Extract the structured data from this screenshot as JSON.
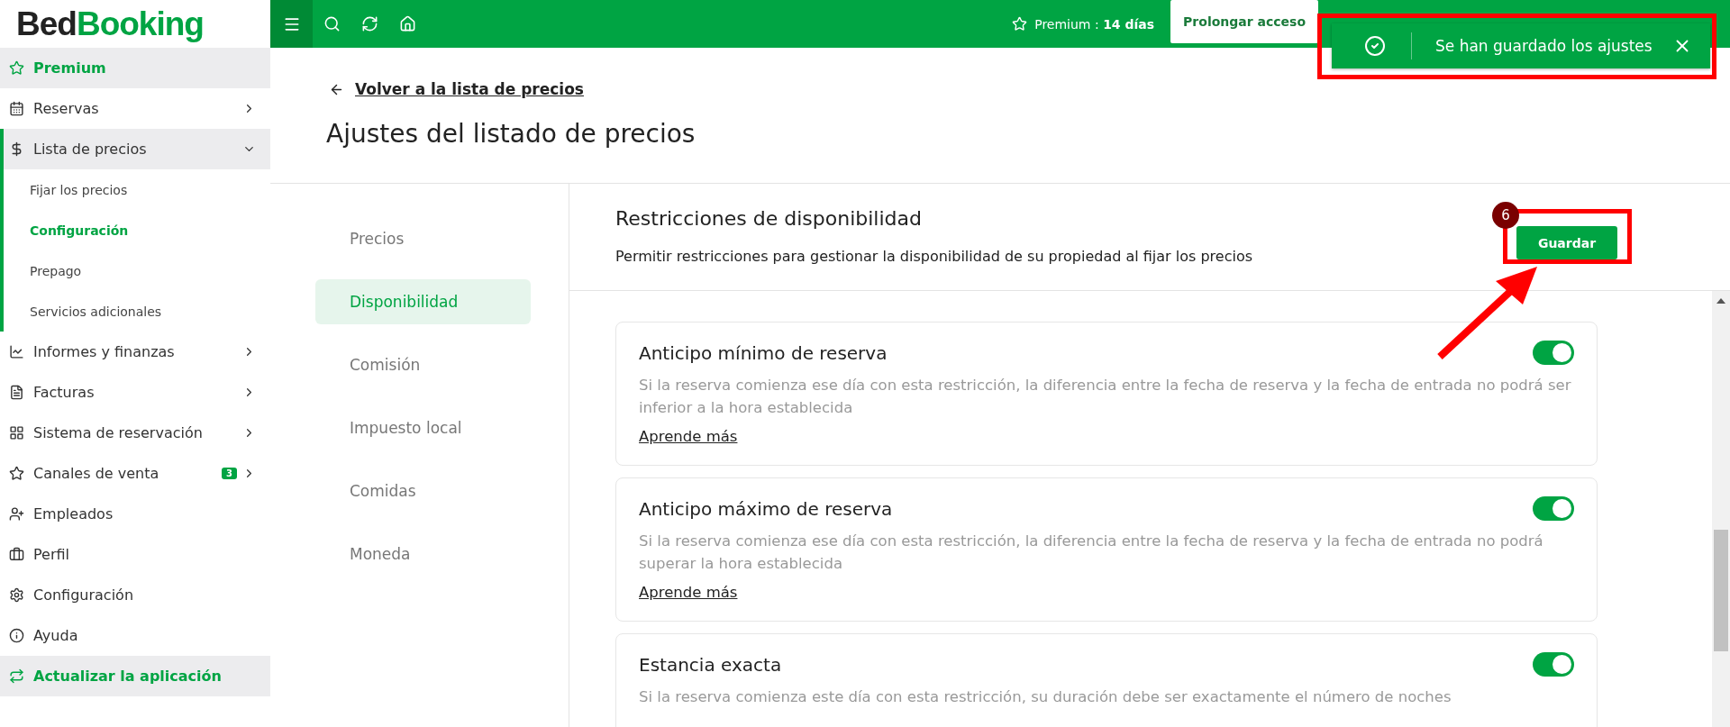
{
  "logo": {
    "dark_part": "Bed",
    "green_part": "Booking"
  },
  "top_bar": {
    "premium": "Premium : **14 días**",
    "extend_button": "Prolongar acceso"
  },
  "toast": {
    "message": "Se han guardado los ajustes"
  },
  "sidebar": {
    "items": [
      {
        "kind": "premium",
        "label": "Premium",
        "expandable": false
      },
      {
        "kind": "item",
        "label": "Reservas",
        "expandable": true
      },
      {
        "kind": "group",
        "label": "Lista de precios",
        "expandable": true,
        "expanded": true,
        "children": [
          {
            "label": "Fijar los precios",
            "selected": false
          },
          {
            "label": "Configuración",
            "selected": true
          },
          {
            "label": "Prepago",
            "selected": false
          },
          {
            "label": "Servicios adicionales",
            "selected": false
          }
        ]
      },
      {
        "kind": "item",
        "label": "Informes y finanzas",
        "expandable": true
      },
      {
        "kind": "item",
        "label": "Facturas",
        "expandable": true
      },
      {
        "kind": "item",
        "label": "Sistema de reservación",
        "expandable": true
      },
      {
        "kind": "item",
        "label": "Canales de venta",
        "expandable": true,
        "badge": "3"
      },
      {
        "kind": "item",
        "label": "Empleados",
        "expandable": false
      },
      {
        "kind": "item",
        "label": "Perfil",
        "expandable": false
      },
      {
        "kind": "item",
        "label": "Configuración",
        "expandable": false
      },
      {
        "kind": "item",
        "label": "Ayuda",
        "expandable": false
      },
      {
        "kind": "action",
        "label": "Actualizar la aplicación",
        "expandable": false
      }
    ]
  },
  "header": {
    "back_link": "Volver a la lista de precios",
    "title": "Ajustes del listado de precios"
  },
  "settings_nav": [
    {
      "label": "Precios",
      "selected": false
    },
    {
      "label": "Disponibilidad",
      "selected": true
    },
    {
      "label": "Comisión",
      "selected": false
    },
    {
      "label": "Impuesto local",
      "selected": false
    },
    {
      "label": "Comidas",
      "selected": false
    },
    {
      "label": "Moneda",
      "selected": false
    }
  ],
  "section": {
    "title": "Restricciones de disponibilidad",
    "description": "Permitir restricciones para gestionar la disponibilidad de su propiedad al fijar los precios",
    "save_button": "Guardar"
  },
  "cards": [
    {
      "title": "Anticipo mínimo de reserva",
      "on": true,
      "description": "Si la reserva comienza ese día con esta restricción, la diferencia entre la fecha de reserva y la fecha de entrada no podrá ser inferior a la hora establecida",
      "link": "Aprende más"
    },
    {
      "title": "Anticipo máximo de reserva",
      "on": true,
      "description": "Si la reserva comienza ese día con esta restricción, la diferencia entre la fecha de reserva y la fecha de entrada no podrá superar la hora establecida",
      "link": "Aprende más"
    },
    {
      "title": "Estancia exacta",
      "on": true,
      "description": "Si la reserva comienza este día con esta restricción, su duración debe ser exactamente el número de noches"
    }
  ],
  "annotation": {
    "step_number": "6"
  }
}
